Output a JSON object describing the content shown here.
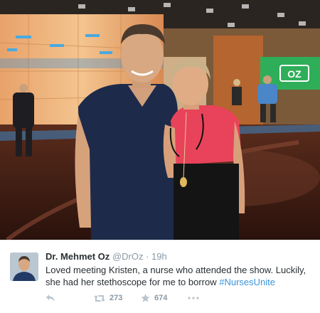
{
  "photo": {
    "screen_logo": "OZ"
  },
  "tweet": {
    "display_name": "Dr. Mehmet Oz",
    "handle": "@DrOz",
    "separator": "·",
    "time": "19h",
    "text": "Loved meeting Kristen, a nurse who attended the show. Luckily, she had her stethoscope for me to borrow ",
    "hashtag": "#NursesUnite",
    "reply_icon": "reply-icon",
    "retweet_icon": "retweet-icon",
    "retweet_count": "273",
    "favorite_icon": "star-icon",
    "favorite_count": "674",
    "more_icon": "more-dots-icon"
  },
  "colors": {
    "link": "#3b94d9",
    "text": "#292f33",
    "muted": "#8899a6"
  }
}
